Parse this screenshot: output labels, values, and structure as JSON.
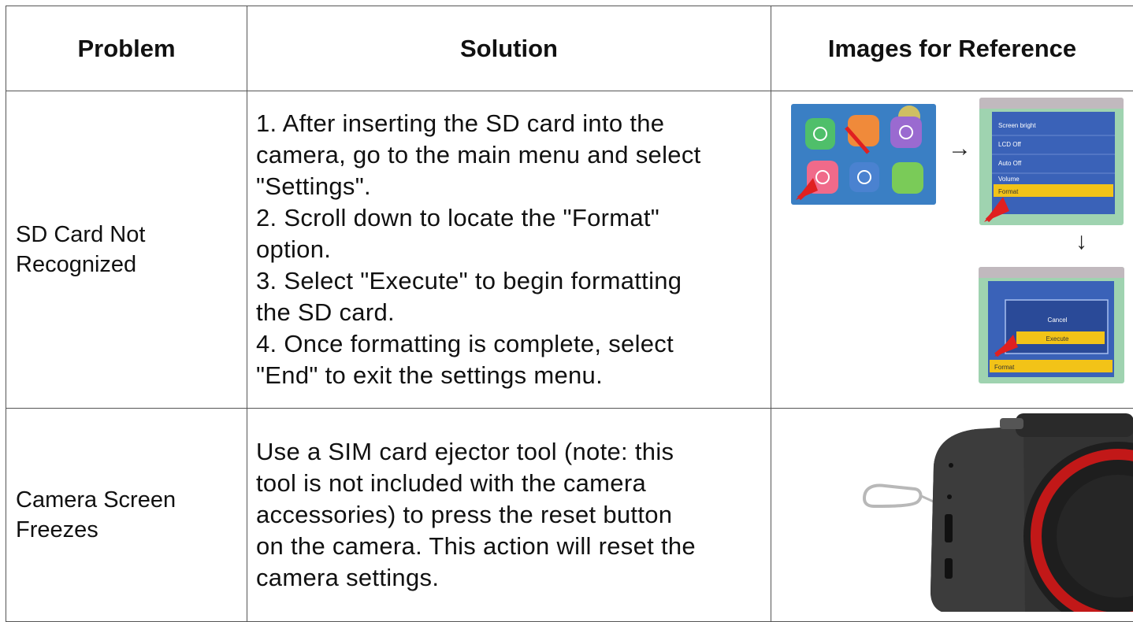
{
  "headers": {
    "problem": "Problem",
    "solution": "Solution",
    "images": "Images for Reference"
  },
  "rows": [
    {
      "problem": [
        "SD Card Not",
        "Recognized"
      ],
      "solution": [
        "1. After inserting the SD card into the",
        "camera, go to the main menu and select",
        "\"Settings\".",
        "2. Scroll down to locate the \"Format\"",
        "option.",
        "3. Select \"Execute\" to begin formatting",
        "the SD card.",
        "4. Once formatting is complete, select",
        "\"End\" to exit the settings menu."
      ],
      "screens": {
        "menu2": [
          "Screen bright",
          "LCD Off",
          "Auto Off",
          "Volume",
          "Format"
        ],
        "menu3": [
          "Cancel",
          "Execute",
          "Format"
        ]
      },
      "arrows": {
        "right": "→",
        "down": "↓"
      }
    },
    {
      "problem": [
        "Camera Screen",
        "Freezes"
      ],
      "solution": [
        "Use a SIM card ejector tool (note: this",
        "tool is not included with the camera",
        "accessories) to press the reset button",
        "on the camera. This action will reset the",
        "camera settings."
      ]
    }
  ],
  "colors": {
    "highlight": "#f2c318",
    "screen_blue": "#3a62b8",
    "screen_bg": "#8ec6e8",
    "red_arrow": "#e02020"
  }
}
